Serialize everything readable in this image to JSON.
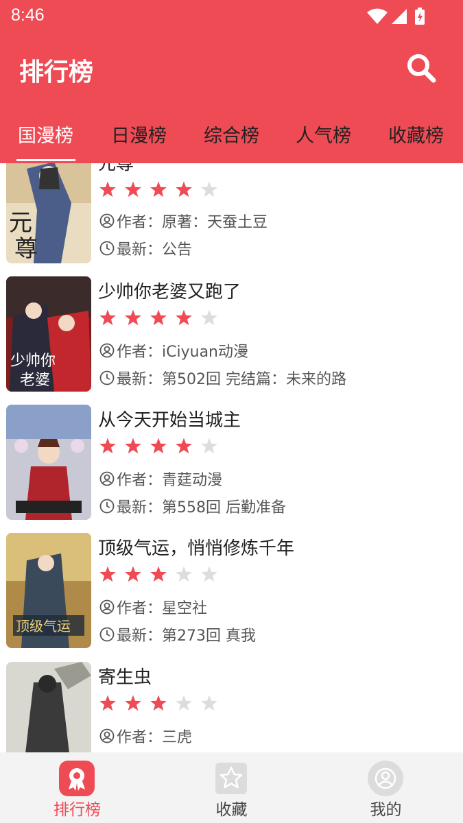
{
  "status_bar": {
    "time": "8:46"
  },
  "header": {
    "title": "排行榜"
  },
  "tabs": [
    {
      "label": "国漫榜",
      "active": true
    },
    {
      "label": "日漫榜",
      "active": false
    },
    {
      "label": "综合榜",
      "active": false
    },
    {
      "label": "人气榜",
      "active": false
    },
    {
      "label": "收藏榜",
      "active": false
    }
  ],
  "meta_labels": {
    "author": "作者：",
    "latest": "最新："
  },
  "items": [
    {
      "title": "元尊",
      "stars": 4,
      "author": "原著：天蚕土豆",
      "latest": "公告"
    },
    {
      "title": "少帅你老婆又跑了",
      "stars": 4,
      "author": "iCiyuan动漫",
      "latest": "第502回 完结篇：未来的路"
    },
    {
      "title": "从今天开始当城主",
      "stars": 4,
      "author": "青莛动漫",
      "latest": "第558回 后勤准备"
    },
    {
      "title": "顶级气运，悄悄修炼千年",
      "stars": 3,
      "author": "星空社",
      "latest": "第273回 真我"
    },
    {
      "title": "寄生虫",
      "stars": 3,
      "author": "三虎",
      "latest": ""
    }
  ],
  "bottom_nav": [
    {
      "label": "排行榜",
      "active": true
    },
    {
      "label": "收藏",
      "active": false
    },
    {
      "label": "我的",
      "active": false
    }
  ],
  "colors": {
    "accent": "#ef4b55",
    "star_on": "#ef4b55",
    "star_off": "#dddddd"
  }
}
